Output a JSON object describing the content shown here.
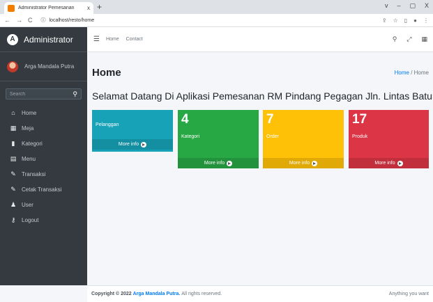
{
  "browser": {
    "tab_title": "Administrator Pemesanan",
    "tab_close": "x",
    "new_tab": "+",
    "url": "localhost/resto/home",
    "window_controls": [
      "v",
      "–",
      "▢",
      "X"
    ]
  },
  "sidebar": {
    "brand": "Administrator",
    "user_name": "Arga Mandala Putra",
    "search_placeholder": "Search",
    "items": [
      {
        "label": "Home",
        "icon": "home-icon"
      },
      {
        "label": "Meja",
        "icon": "table-icon"
      },
      {
        "label": "Kategori",
        "icon": "book-icon"
      },
      {
        "label": "Menu",
        "icon": "list-icon"
      },
      {
        "label": "Transaksi",
        "icon": "pencil-icon"
      },
      {
        "label": "Cetak Transaksi",
        "icon": "pencil-icon"
      },
      {
        "label": "User",
        "icon": "user-icon"
      },
      {
        "label": "Logout",
        "icon": "key-icon"
      }
    ]
  },
  "topnav": {
    "links": [
      "Home",
      "Contact"
    ]
  },
  "header": {
    "title": "Home",
    "breadcrumb_link": "Home",
    "breadcrumb_sep": " / ",
    "breadcrumb_current": "Home"
  },
  "welcome": "Selamat Datang Di Aplikasi Pemesanan RM Pindang Pegagan Jln. Lintas Baturaja Desa",
  "boxes": [
    {
      "label": "Pelanggan",
      "more": "More info",
      "color": "#17a2b8"
    },
    {
      "number": "4",
      "label": "Kategori",
      "more": "More info",
      "color": "#28a745"
    },
    {
      "number": "7",
      "label": "Order",
      "more": "More info",
      "color": "#ffc107"
    },
    {
      "number": "17",
      "label": "Produk",
      "more": "More info",
      "color": "#dc3545"
    }
  ],
  "footer": {
    "copyright_prefix": "Copyright © 2022",
    "author": "Arga Mandala Putra.",
    "rights": "All rights reserved.",
    "right_text": "Anything you want"
  }
}
